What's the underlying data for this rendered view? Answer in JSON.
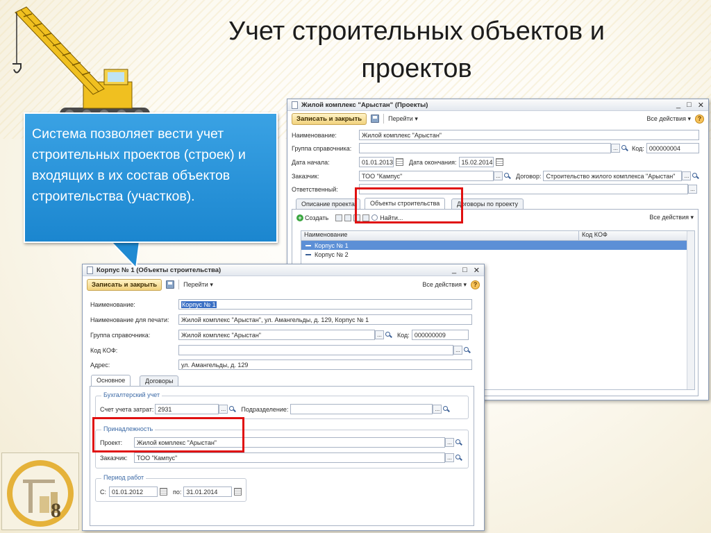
{
  "slide": {
    "title_line1": "Учет строительных объектов и",
    "title_line2": "проектов",
    "callout_text": "Система позволяет вести учет строительных проектов (строек) и входящих в их состав объектов строительства (участков).",
    "logo_text": "8"
  },
  "project_window": {
    "title": "Жилой комплекс \"Арыстан\" (Проекты)",
    "save_label": "Записать и закрыть",
    "goto_label": "Перейти ▾",
    "all_actions_label": "Все действия ▾",
    "help_label": "?",
    "fields": {
      "name_label": "Наименование:",
      "name_value": "Жилой комплекс \"Арыстан\"",
      "group_label": "Группа справочника:",
      "group_value": "",
      "code_label": "Код:",
      "code_value": "000000004",
      "start_label": "Дата начала:",
      "start_value": "01.01.2013",
      "end_label": "Дата окончания:",
      "end_value": "15.02.2014",
      "customer_label": "Заказчик:",
      "customer_value": "ТОО \"Кампус\"",
      "contract_label": "Договор:",
      "contract_value": "Строительство жилого комплекса \"Арыстан\"",
      "responsible_label": "Ответственный:",
      "responsible_value": ""
    },
    "tabs": [
      "Описание проекта",
      "Объекты строительства",
      "Договоры по проекту"
    ],
    "grid_toolbar": {
      "create_label": "Создать",
      "find_label": "Найти...",
      "all_actions_label": "Все действия ▾"
    },
    "grid": {
      "columns": [
        "Наименование",
        "Код КОФ"
      ],
      "rows": [
        {
          "name": "Корпус № 1",
          "code": ""
        },
        {
          "name": "Корпус № 2",
          "code": ""
        }
      ]
    }
  },
  "object_window": {
    "title": "Корпус № 1 (Объекты строительства)",
    "save_label": "Записать и закрыть",
    "goto_label": "Перейти ▾",
    "all_actions_label": "Все действия ▾",
    "help_label": "?",
    "fields": {
      "name_label": "Наименование:",
      "name_value": "Корпус № 1",
      "print_name_label": "Наименование для печати:",
      "print_name_value": "Жилой комплекс \"Арыстан\", ул. Амангельды, д. 129, Корпус № 1",
      "group_label": "Группа справочника:",
      "group_value": "Жилой комплекс \"Арыстан\"",
      "code_label": "Код:",
      "code_value": "000000009",
      "kof_label": "Код КОФ:",
      "kof_value": "",
      "address_label": "Адрес:",
      "address_value": "ул. Амангельды, д. 129"
    },
    "tabs": [
      "Основное",
      "Договоры"
    ],
    "accounting": {
      "title": "Бухгалтерский учет",
      "account_label": "Счет учета затрат:",
      "account_value": "2931",
      "division_label": "Подразделение:",
      "division_value": ""
    },
    "ownership": {
      "title": "Принадлежность",
      "project_label": "Проект:",
      "project_value": "Жилой комплекс \"Арыстан\"",
      "customer_label": "Заказчик:",
      "customer_value": "ТОО \"Кампус\""
    },
    "period": {
      "title": "Период работ",
      "from_label": "С:",
      "from_value": "01.01.2012",
      "to_label": "по:",
      "to_value": "31.01.2014"
    }
  },
  "colors": {
    "callout": "#1b86cf",
    "highlight": "#e01010",
    "selection": "#5c8fd6",
    "save_button": "#f2d27d"
  },
  "icons": [
    "crane-icon",
    "document-icon",
    "floppy-icon",
    "help-icon",
    "magnifier-icon",
    "calendar-icon",
    "create-icon"
  ]
}
